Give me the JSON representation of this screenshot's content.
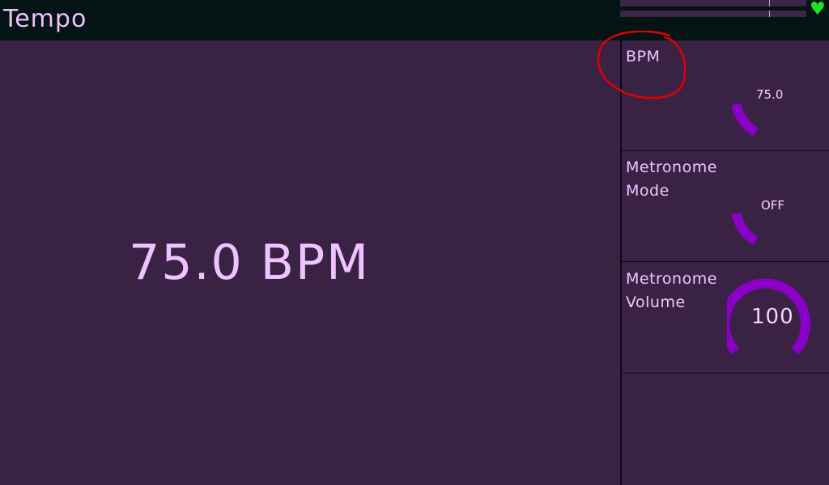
{
  "header": {
    "title": "Tempo",
    "status_icon": "heart-icon"
  },
  "main": {
    "display_value": "75.0 BPM"
  },
  "panels": [
    {
      "label": "BPM",
      "value": "75.0",
      "knob_level": 0.1
    },
    {
      "label": "Metronome Mode",
      "value": "OFF",
      "knob_level": 0.08
    },
    {
      "label": "Metronome Volume",
      "value": "100",
      "knob_level": 1.0
    },
    {
      "label": "",
      "value": ""
    }
  ],
  "colors": {
    "background": "#3a2245",
    "topbar": "#041313",
    "accent": "#8a00c8",
    "text": "#ecb8ff",
    "status_green": "#22e322",
    "annotation_red": "#e00000"
  }
}
